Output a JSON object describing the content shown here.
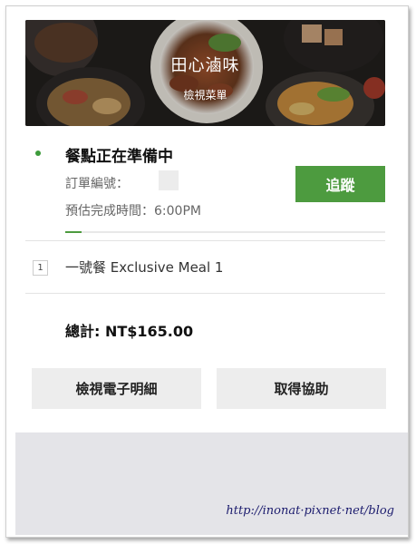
{
  "restaurant": {
    "name": "田心滷味",
    "view_menu": "檢視菜單"
  },
  "order": {
    "status": "餐點正在準備中",
    "number_label": "訂單編號：",
    "eta": "預估完成時間：6:00PM",
    "track_label": "追蹤",
    "progress": 0.05
  },
  "items": [
    {
      "qty": "1",
      "name": "一號餐 Exclusive Meal 1"
    }
  ],
  "summary": {
    "total": "總計: NT$165.00"
  },
  "actions": {
    "receipt_label": "檢視電子明細",
    "help_label": "取得協助"
  },
  "watermark": "http://inonat·pixnet·net/blog",
  "colors": {
    "accent": "#4d9b3f",
    "status_dot": "#3d9b3b",
    "button_bg": "#ededed",
    "background_gray": "#e4e4e8"
  }
}
